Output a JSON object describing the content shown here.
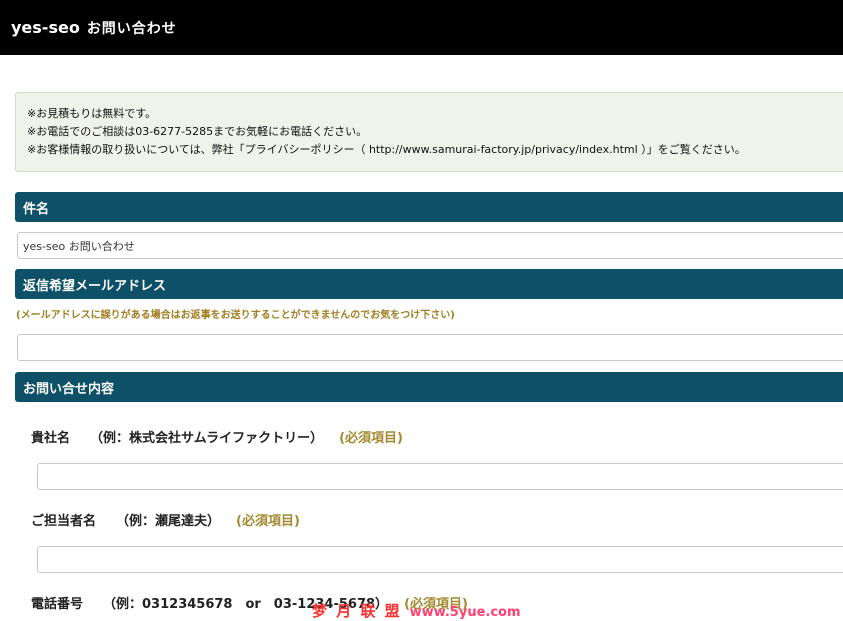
{
  "header": {
    "brand": "yes-seo",
    "title": "お問い合わせ"
  },
  "notice": {
    "lines": [
      "※お見積もりは無料です。",
      "※お電話でのご相談は03-6277-5285までお気軽にお電話ください。",
      "※お客様情報の取り扱いについては、弊社「プライバシーポリシー（ http://www.samurai-factory.jp/privacy/index.html ）」をご覧ください。"
    ]
  },
  "sections": {
    "subject": {
      "label": "件名",
      "value": "yes-seo お問い合わせ"
    },
    "email": {
      "label": "返信希望メールアドレス",
      "warning": "(メールアドレスに誤りがある場合はお返事をお送りすることができませんのでお気をつけ下さい)",
      "value": ""
    },
    "inquiry": {
      "label": "お問い合せ内容"
    }
  },
  "fields": {
    "company": {
      "label": "貴社名",
      "example": "（例：株式会社サムライファクトリー）",
      "required": "(必須項目)",
      "value": ""
    },
    "person": {
      "label": "ご担当者名",
      "example": "（例：瀬尾達夫）",
      "required": "(必須項目)",
      "value": ""
    },
    "phone": {
      "label": "電話番号",
      "example": "（例：0312345678　or　03-1234-5678）",
      "required": "(必須項目)"
    }
  },
  "watermark": {
    "text": "梦 月 联 盟",
    "url": "www.5yue.com"
  }
}
